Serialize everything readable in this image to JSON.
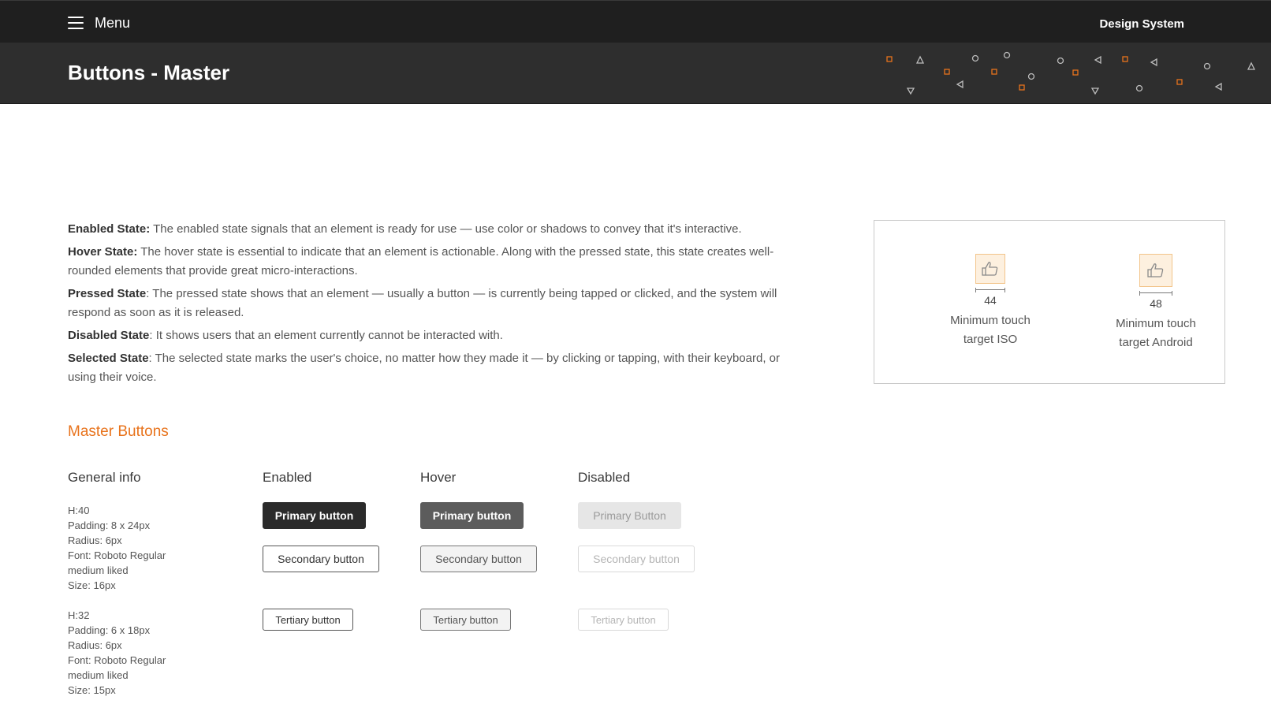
{
  "topbar": {
    "menu_label": "Menu",
    "brand": "Design System"
  },
  "header": {
    "title": "Buttons - Master"
  },
  "states": [
    {
      "term": "Enabled State:",
      "text": " The enabled state signals that an element is ready for use — use color or shadows to convey that it's interactive."
    },
    {
      "term": "Hover State:",
      "text": " The hover state is essential to indicate that an element is actionable. Along with the pressed state, this state creates well-rounded elements that provide great micro-interactions."
    },
    {
      "term": "Pressed State",
      "text": ": The pressed state shows that an element — usually a button — is currently being tapped or clicked, and the system will respond as soon as it is released."
    },
    {
      "term": "Disabled State",
      "text": ": It shows users that an element currently cannot be interacted with."
    },
    {
      "term": "Selected State",
      "text": ": The selected state marks the user's choice, no matter how they made it — by clicking or tapping, with their keyboard, or using their voice."
    }
  ],
  "touch_targets": [
    {
      "value": "44",
      "label_line1": "Minimum touch",
      "label_line2": "target ISO",
      "icon": "thumbs-up-icon"
    },
    {
      "value": "48",
      "label_line1": "Minimum touch",
      "label_line2": "target Android",
      "icon": "thumbs-up-icon"
    }
  ],
  "master": {
    "title": "Master Buttons",
    "columns": {
      "info": "General info",
      "enabled": "Enabled",
      "hover": "Hover",
      "disabled": "Disabled"
    },
    "info_large": [
      "H:40",
      "Padding: 8 x 24px",
      "Radius: 6px",
      "Font: Roboto Regular",
      "medium liked",
      "Size: 16px"
    ],
    "info_small": [
      "H:32",
      "Padding: 6 x 18px",
      "Radius: 6px",
      "Font: Roboto Regular",
      "medium liked",
      "Size: 15px"
    ],
    "buttons": {
      "primary_enabled": "Primary button",
      "primary_hover": "Primary button",
      "primary_disabled": "Primary Button",
      "secondary_enabled": "Secondary button",
      "secondary_hover": "Secondary button",
      "secondary_disabled": "Secondary button",
      "tertiary_enabled": "Tertiary button",
      "tertiary_hover": "Tertiary button",
      "tertiary_disabled": "Tertiary button"
    }
  },
  "colors": {
    "accent": "#e8731c",
    "topbar": "#1f1f1f",
    "header": "#2e2e2e"
  }
}
